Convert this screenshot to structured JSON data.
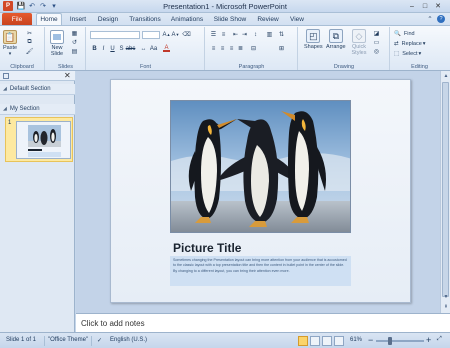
{
  "window": {
    "title": "Presentation1 - Microsoft PowerPoint",
    "controls": [
      "minimize",
      "maximize",
      "close"
    ]
  },
  "quick_access": [
    "save-icon",
    "undo-icon",
    "redo-icon",
    "customize-icon"
  ],
  "tabs": [
    {
      "label": "File"
    },
    {
      "label": "Home"
    },
    {
      "label": "Insert"
    },
    {
      "label": "Design"
    },
    {
      "label": "Transitions"
    },
    {
      "label": "Animations"
    },
    {
      "label": "Slide Show"
    },
    {
      "label": "Review"
    },
    {
      "label": "View"
    }
  ],
  "ribbon": {
    "clipboard": {
      "label": "Clipboard",
      "paste": "Paste"
    },
    "slides": {
      "label": "Slides",
      "new_slide": "New Slide"
    },
    "font": {
      "label": "Font",
      "font_name": "",
      "font_size": ""
    },
    "paragraph": {
      "label": "Paragraph"
    },
    "drawing": {
      "label": "Drawing",
      "shapes": "Shapes",
      "arrange": "Arrange",
      "quick_styles": "Quick Styles"
    },
    "editing": {
      "label": "Editing",
      "find": "Find",
      "replace": "Replace",
      "select": "Select"
    }
  },
  "left_pane": {
    "sections": [
      {
        "label": "Default Section"
      },
      {
        "label": "My Section"
      }
    ],
    "thumbnail_number": "1"
  },
  "slide": {
    "title": "Picture Title",
    "body_1": "Sometimes changing the Presentation layout can bring more attention from your audience that is accustomed to the classic layout with a top presentation title and then the content in bullet point in the center of the slide.",
    "body_2": "By changing to a different layout, you can bring their attention even more."
  },
  "notes": {
    "placeholder": "Click to add notes"
  },
  "status": {
    "slide_info": "Slide 1 of 1",
    "theme": "\"Office Theme\"",
    "language": "English (U.S.)",
    "zoom": "61%",
    "zoom_level": 0.61
  },
  "colors": {
    "file_tab": "#d24726",
    "accent": "#1e395b",
    "selection": "#fde9a0"
  }
}
